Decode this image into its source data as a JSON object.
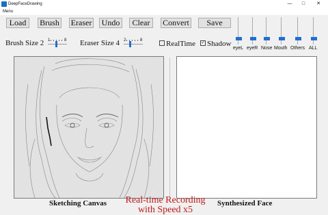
{
  "window": {
    "title": "DeepFaceDrawing",
    "minimize": "—",
    "maximize": "□",
    "close": "✕"
  },
  "menubar": {
    "menu": "Menu"
  },
  "toolbar": {
    "load": "Load",
    "brush": "Brush",
    "eraser": "Eraser",
    "undo": "Undo",
    "clear": "Clear",
    "convert": "Convert",
    "save": "Save"
  },
  "controls": {
    "brush_size_label": "Brush Size 2",
    "brush_min": "1",
    "brush_max": "8",
    "eraser_size_label": "Eraser Size 4",
    "eraser_min": "2",
    "eraser_max": "8",
    "realtime_label": "RealTime",
    "realtime_checked": false,
    "shadow_label": "Shadow",
    "shadow_checked": true
  },
  "component_sliders": [
    {
      "label": "eyeL"
    },
    {
      "label": "eyeR"
    },
    {
      "label": "Nose"
    },
    {
      "label": "Mouth"
    },
    {
      "label": "Others"
    },
    {
      "label": "ALL"
    }
  ],
  "panels": {
    "sketch_caption": "Sketching Canvas",
    "synth_caption": "Synthesized Face"
  },
  "overlay": {
    "line1": "Real-time Recording",
    "line2": "with Speed x5"
  },
  "colors": {
    "accent": "#1f6fd1",
    "overlay_text": "#c01818"
  }
}
